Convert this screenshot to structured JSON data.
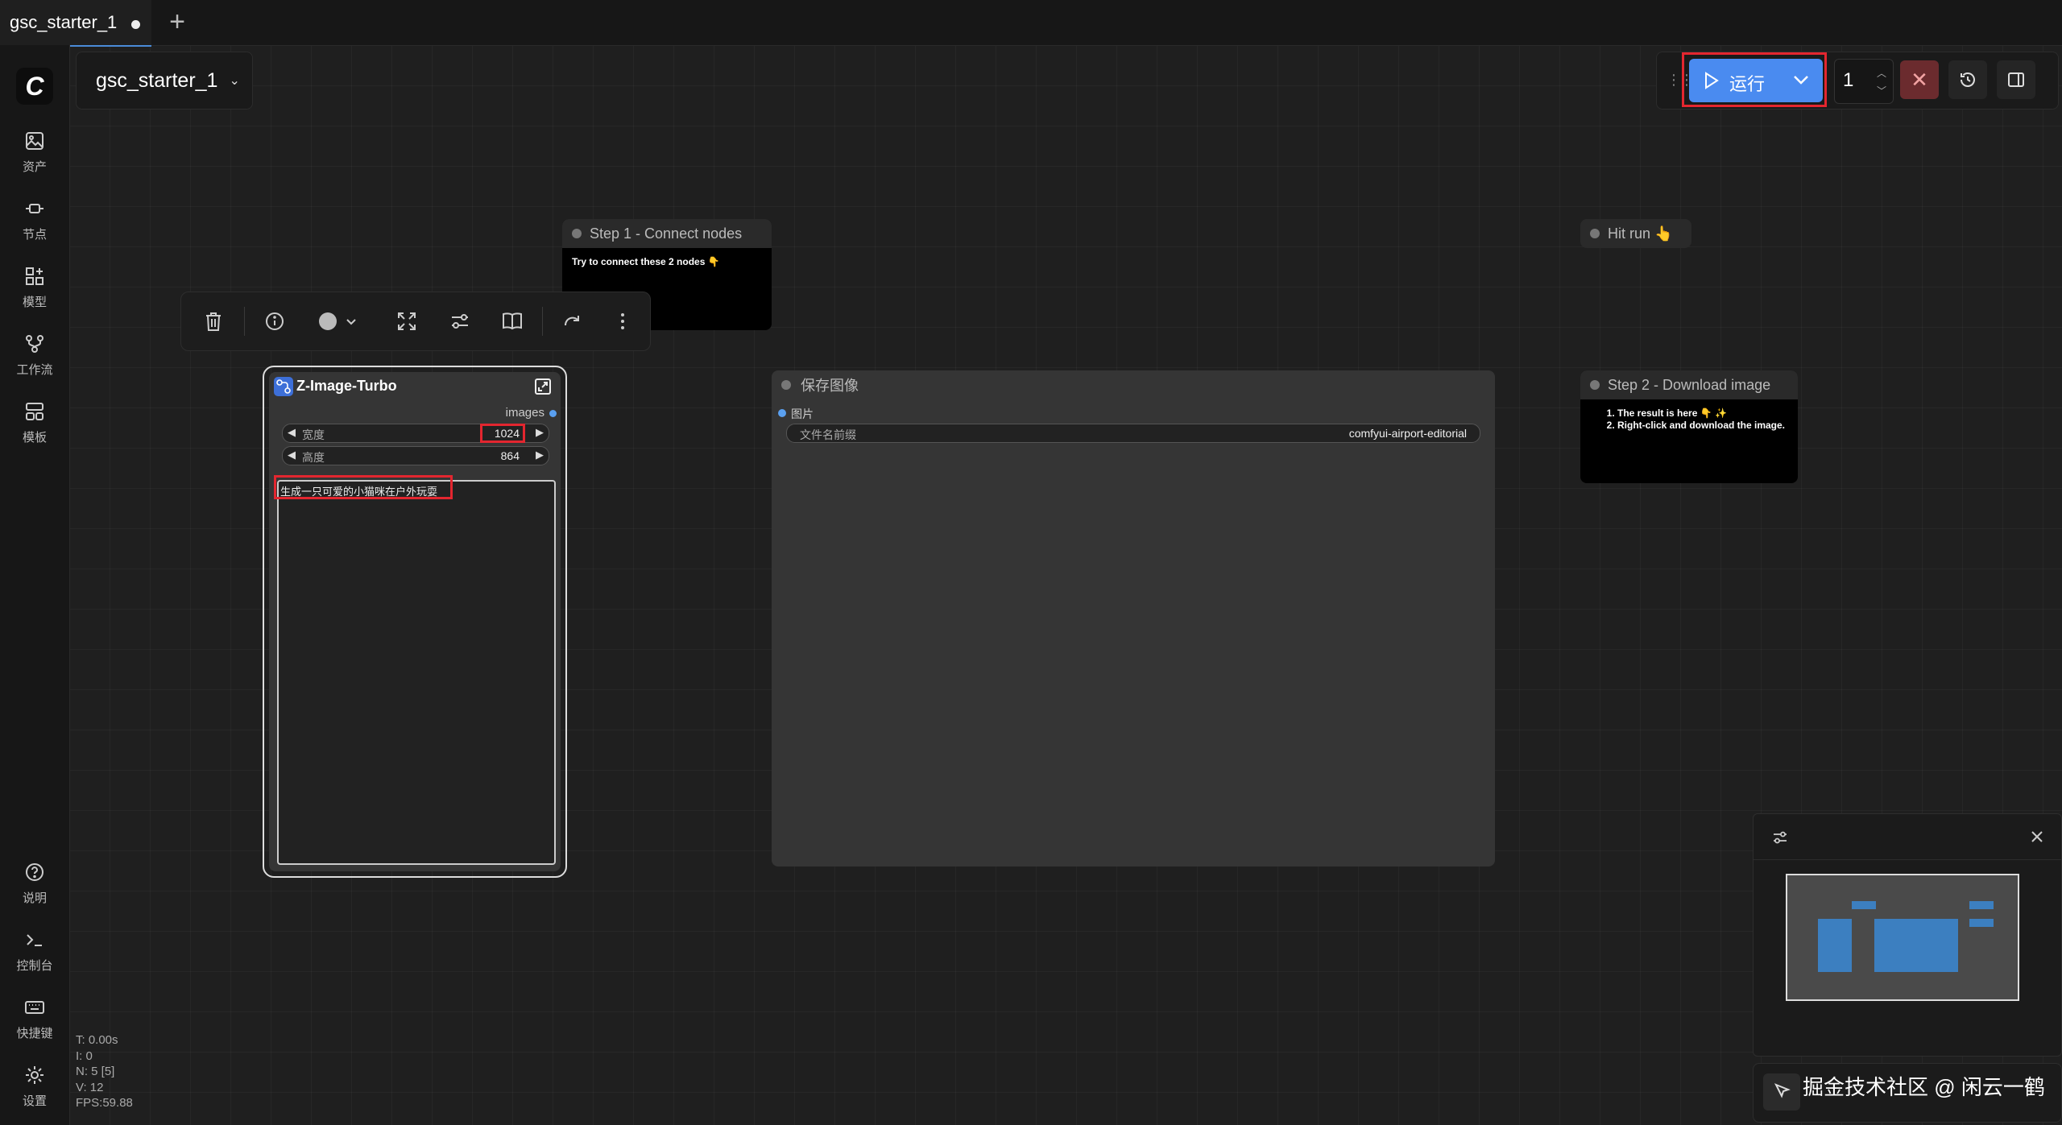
{
  "tabs": [
    {
      "label": "gsc_starter_1",
      "modified": true
    }
  ],
  "sidebar": {
    "items": [
      {
        "id": "assets",
        "label": "资产",
        "icon": "image-icon"
      },
      {
        "id": "nodes",
        "label": "节点",
        "icon": "node-icon"
      },
      {
        "id": "models",
        "label": "模型",
        "icon": "model-icon"
      },
      {
        "id": "workflows",
        "label": "工作流",
        "icon": "workflow-icon"
      },
      {
        "id": "templates",
        "label": "模板",
        "icon": "template-icon"
      }
    ],
    "bottom": [
      {
        "id": "help",
        "label": "说明",
        "icon": "help-icon"
      },
      {
        "id": "console",
        "label": "控制台",
        "icon": "terminal-icon"
      },
      {
        "id": "shortcuts",
        "label": "快捷键",
        "icon": "keyboard-icon"
      },
      {
        "id": "settings",
        "label": "设置",
        "icon": "gear-icon"
      }
    ]
  },
  "workflow": {
    "title": "gsc_starter_1"
  },
  "runbar": {
    "run_label": "运行",
    "count": "1",
    "stop_symbol": "✕"
  },
  "notes": {
    "step1": {
      "title": "Step 1 - Connect nodes",
      "body": "Try to connect these 2 nodes 👇"
    },
    "hitrun": {
      "title": "Hit run 👆"
    },
    "step2": {
      "title": "Step 2 - Download image",
      "items": [
        "The result is here 👇 ✨",
        "Right-click and download the image."
      ]
    }
  },
  "zit_node": {
    "title": "Z-Image-Turbo",
    "output_label": "images",
    "width_label": "宽度",
    "width_value": "1024",
    "height_label": "高度",
    "height_value": "864",
    "prompt": "生成一只可爱的小猫咪在户外玩耍"
  },
  "save_node": {
    "title": "保存图像",
    "input_label": "图片",
    "prefix_label": "文件名前缀",
    "prefix_value": "comfyui-airport-editorial"
  },
  "stats": {
    "t": "T: 0.00s",
    "i": "I: 0",
    "n": "N: 5 [5]",
    "v": "V: 12",
    "fps": "FPS:59.88"
  },
  "watermark": "掘金技术社区 @ 闲云一鹤",
  "colors": {
    "accent": "#4a8bf0",
    "highlight": "#e3262f",
    "stop": "#6b2b2e"
  }
}
